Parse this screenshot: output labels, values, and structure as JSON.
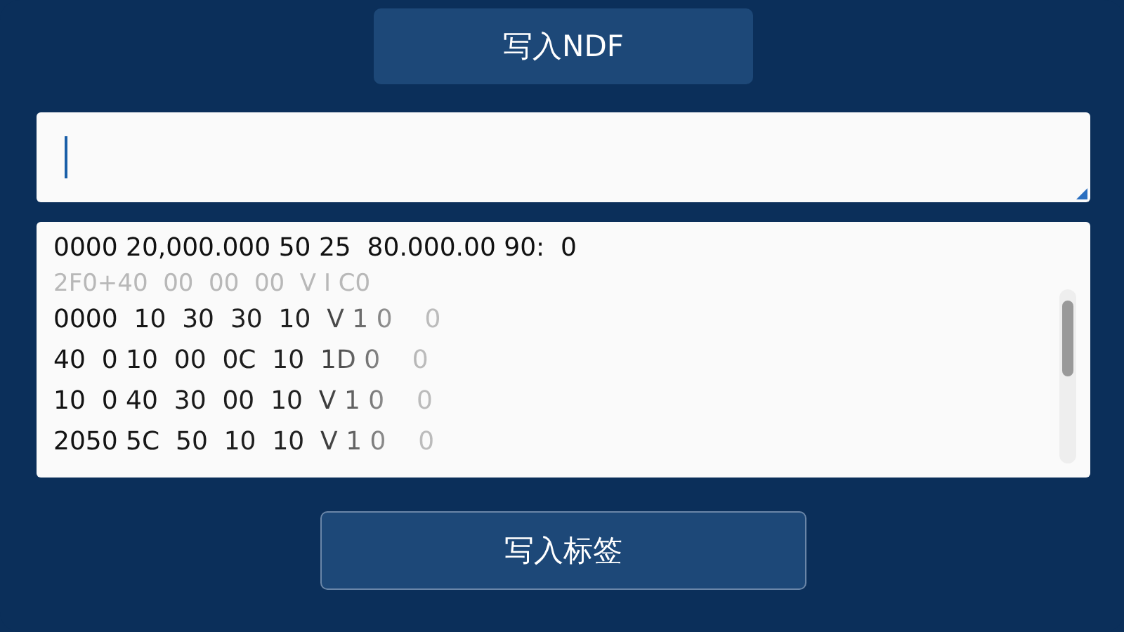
{
  "title_button": {
    "label": "写入NDF"
  },
  "input": {
    "focused": true
  },
  "data_lines": [
    {
      "text": "0000 20,000.000 50 25  80.000.00 90:  0",
      "dim": false
    },
    {
      "text": "2F0+40  00  00  00  V I C0",
      "dim": true
    },
    {
      "text": "0000  10  30  30  10  V 1 0    0",
      "dim": false
    },
    {
      "text": "40  0 10  00  0C  10  1D 0    0",
      "dim": false
    },
    {
      "text": "10  0 40  30  00  10  V 1 0    0",
      "dim": false
    },
    {
      "text": "2050 5C  50  10  10  V 1 0    0",
      "dim": false
    }
  ],
  "write_button": {
    "label": "写入标签"
  }
}
